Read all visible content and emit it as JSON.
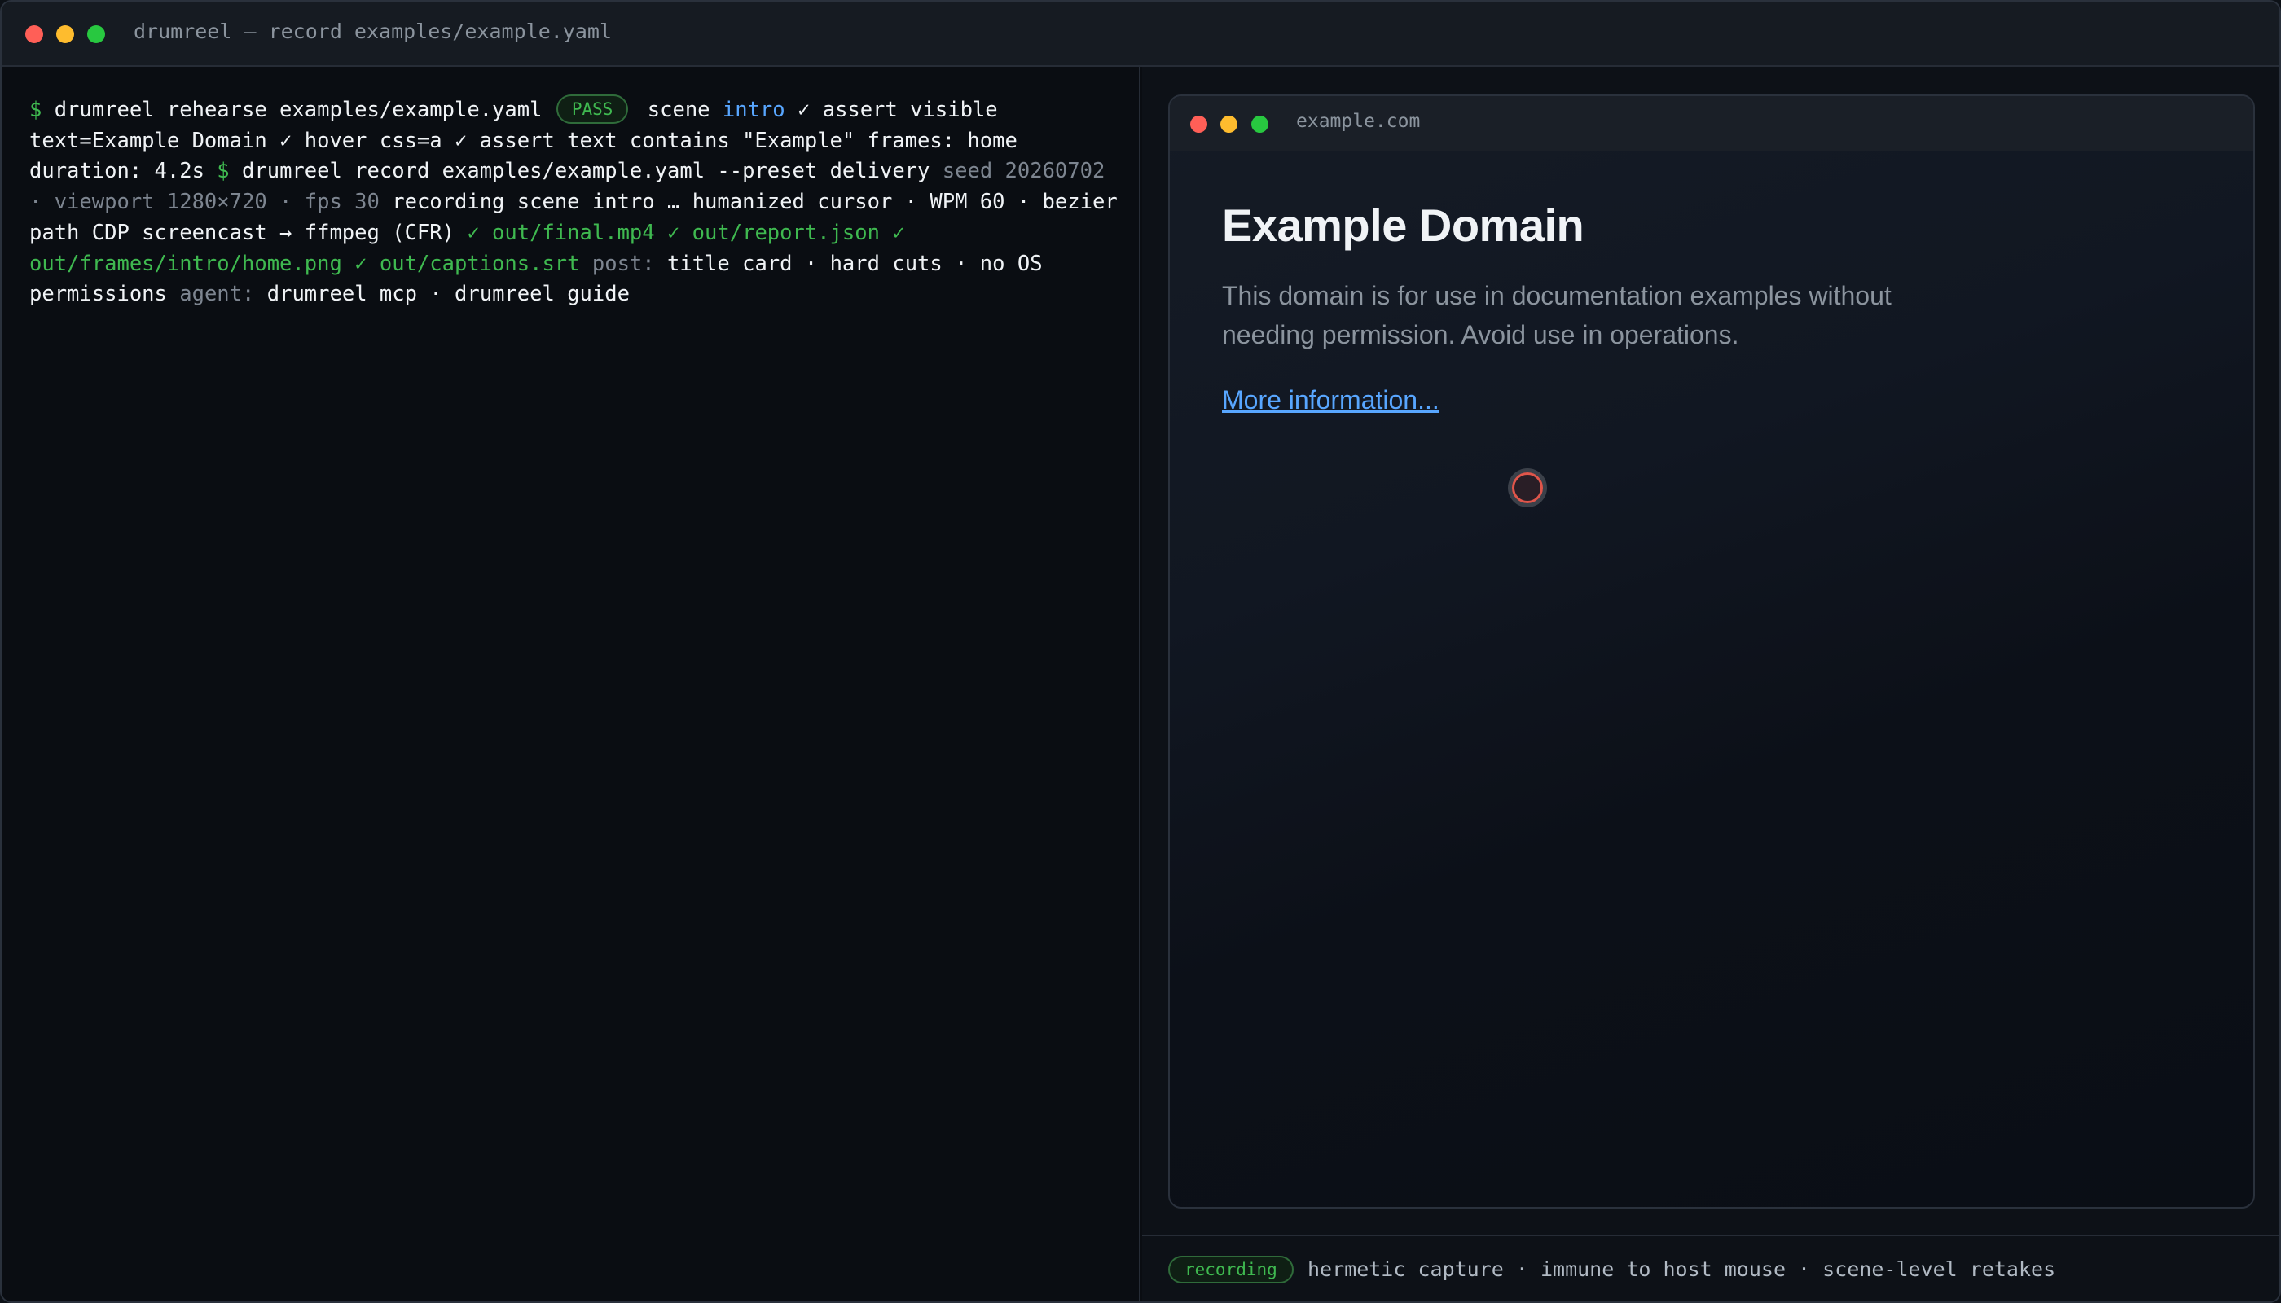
{
  "window": {
    "title": "drumreel — record examples/example.yaml"
  },
  "terminal": {
    "prompt1": "$",
    "cmd1": "drumreel rehearse examples/example.yaml",
    "pass_badge": "PASS",
    "scene_label": "scene",
    "scene_name": "intro",
    "rehearse_steps": "✓ assert visible text=Example Domain ✓ hover css=a ✓ assert text contains \"Example\" frames: home duration: 4.2s",
    "prompt2": "$",
    "cmd2": "drumreel record examples/example.yaml --preset delivery",
    "record_meta": "seed 20260702 · viewport 1280×720 · fps 30",
    "record_progress": "recording scene intro … humanized cursor · WPM 60 · bezier path CDP screencast → ffmpeg (CFR)",
    "outputs": "✓ out/final.mp4 ✓ out/report.json ✓ out/frames/intro/home.png ✓ out/captions.srt",
    "post_label": "post:",
    "post_value": "title card · hard cuts · no OS permissions",
    "agent_label": "agent:",
    "agent_value": "drumreel mcp · drumreel guide"
  },
  "browser": {
    "url": "example.com",
    "heading": "Example Domain",
    "paragraph": "This domain is for use in documentation examples without needing permission. Avoid use in operations.",
    "link": "More information..."
  },
  "status": {
    "badge": "recording",
    "text": "hermetic capture · immune to host mouse · scene-level retakes"
  },
  "colors": {
    "accent_green": "#3fb950",
    "accent_blue": "#58a6ff",
    "cursor_red": "#e0564b"
  },
  "icons": [
    "close-dot-icon",
    "minimize-dot-icon",
    "maximize-dot-icon",
    "cursor-ring-icon"
  ]
}
